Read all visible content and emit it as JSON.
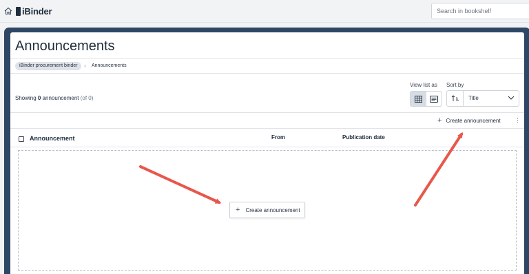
{
  "header": {
    "logo_text": "iBinder",
    "search_placeholder": "Search in bookshelf"
  },
  "page": {
    "title": "Announcements",
    "breadcrumb": {
      "parent": "iBinder procurement binder",
      "current": "Announcements"
    }
  },
  "toolbar": {
    "showing_prefix": "Showing ",
    "showing_count": "0",
    "showing_noun": " announcement ",
    "showing_of": "(of 0)",
    "view_label": "View list as",
    "sort_label": "Sort by",
    "sort_value": "Title",
    "create_label": "Create announcement",
    "more_icon": "⋮"
  },
  "table": {
    "columns": [
      "Announcement",
      "From",
      "Publication date"
    ]
  },
  "empty_state": {
    "create_label": "Create announcement"
  },
  "colors": {
    "frame": "#2e4766",
    "annotation_arrow": "#e8574b"
  }
}
